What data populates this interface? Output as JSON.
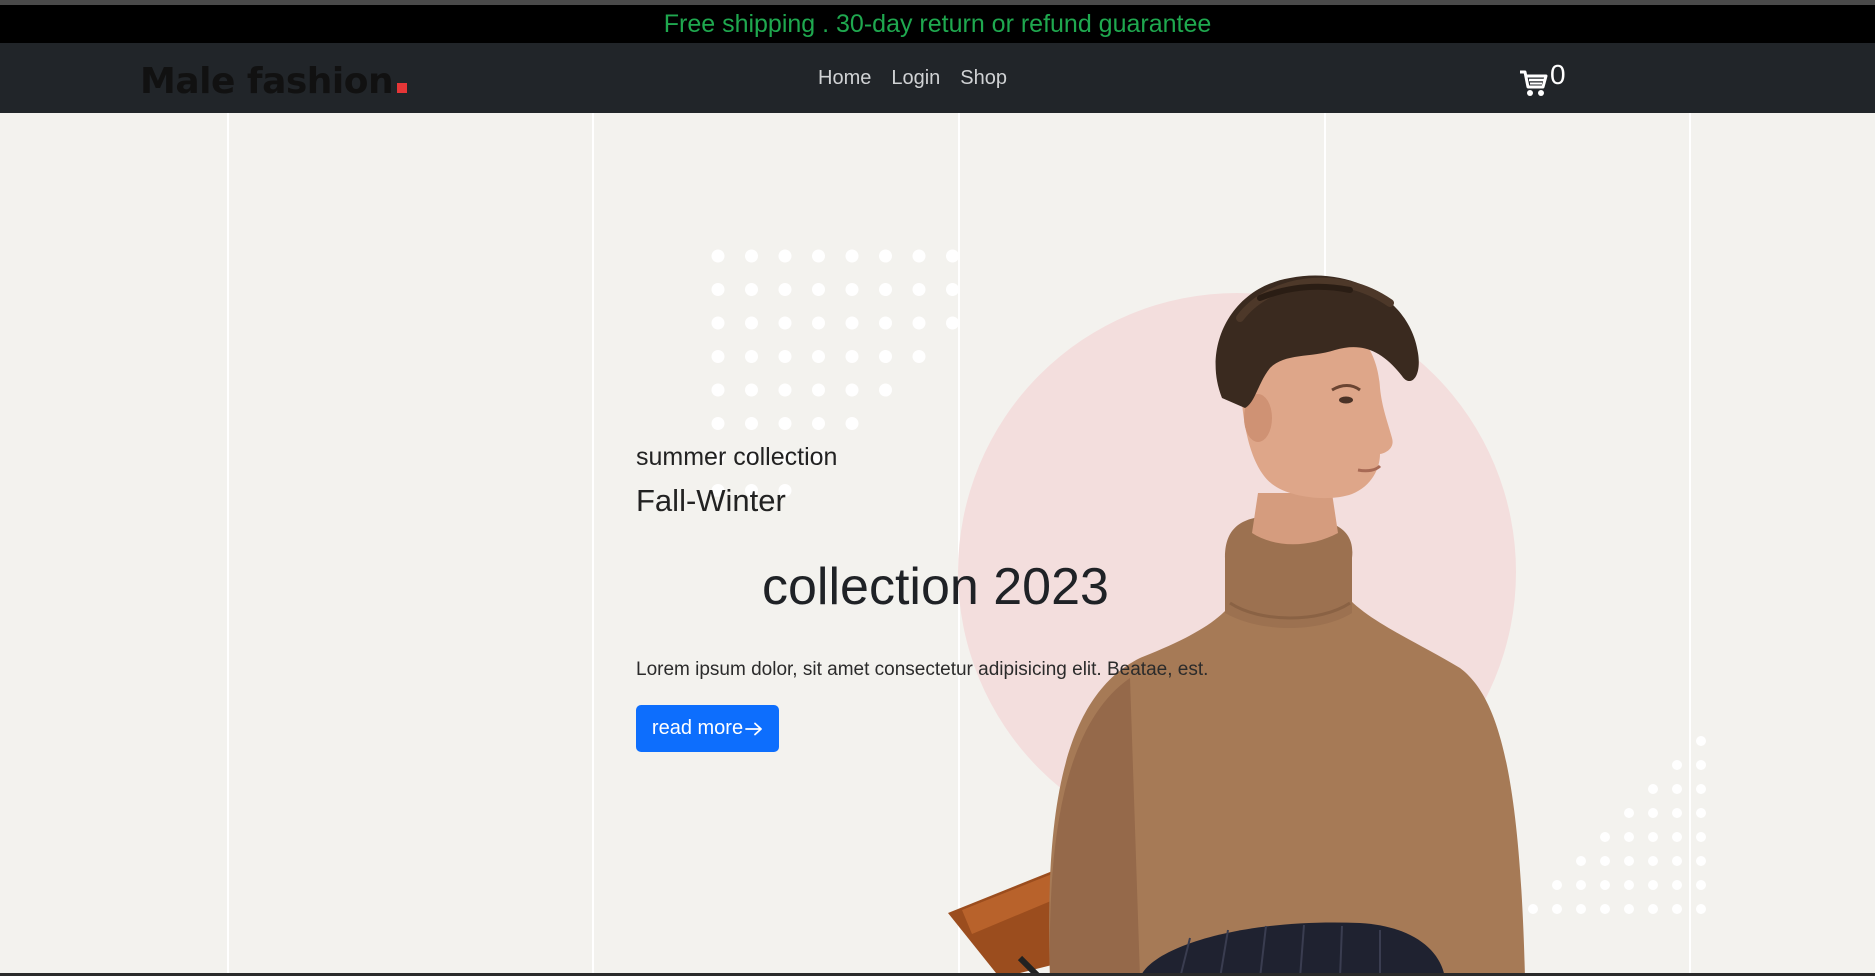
{
  "announcement": {
    "text": "Free shipping . 30-day return or refund guarantee"
  },
  "header": {
    "logo_text": "Male fashion",
    "nav": [
      {
        "label": "Home"
      },
      {
        "label": "Login"
      },
      {
        "label": "Shop"
      }
    ],
    "cart": {
      "icon": "cart-icon",
      "count": "0"
    }
  },
  "hero": {
    "subtitle": "summer collection",
    "season": "Fall-Winter",
    "heading": "collection 2023",
    "description": "Lorem ipsum dolor, sit amet consectetur adipisicing elit. Beatae, est.",
    "button": {
      "label": "read more",
      "icon": "arrow-right-icon"
    }
  },
  "colors": {
    "announcement_text": "#1fa84f",
    "navbar_bg": "#212529",
    "hero_bg": "#f3f2ee",
    "accent_circle": "#f3dedd",
    "logo_dot": "#e53637",
    "button_bg": "#0d6efd",
    "sweater": "#a67a56"
  }
}
